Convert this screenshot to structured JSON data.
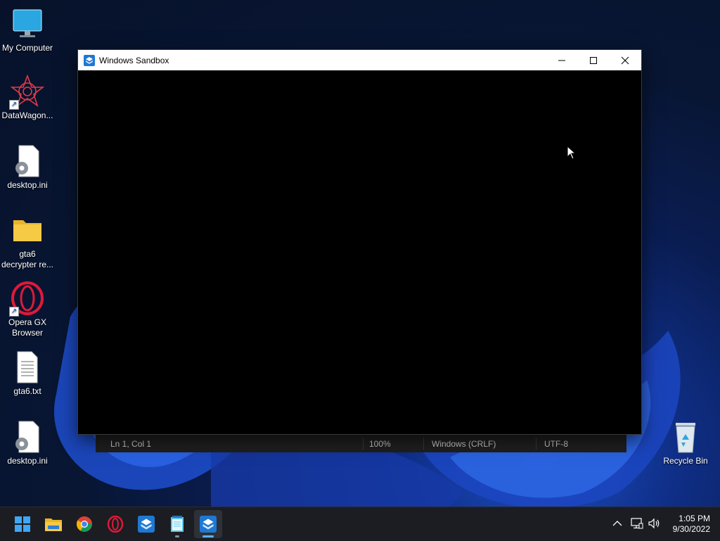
{
  "desktop": {
    "icons": [
      {
        "label": "My Computer"
      },
      {
        "label": "DataWagon..."
      },
      {
        "label": "desktop.ini"
      },
      {
        "label": "gta6\ndecrypter re..."
      },
      {
        "label": "Opera GX\nBrowser"
      },
      {
        "label": "gta6.txt"
      },
      {
        "label": "desktop.ini"
      }
    ],
    "recycle_bin": {
      "label": "Recycle Bin"
    }
  },
  "window": {
    "title": "Windows Sandbox",
    "icon": "sandbox-icon"
  },
  "statusbar": {
    "position": "Ln 1, Col 1",
    "zoom": "100%",
    "line_ending": "Windows (CRLF)",
    "encoding": "UTF-8"
  },
  "taskbar": {
    "items": [
      "start-icon",
      "file-explorer-icon",
      "chrome-icon",
      "opera-gx-icon",
      "sandbox-icon",
      "notepad-icon",
      "sandbox-icon"
    ],
    "time": "1:05 PM",
    "date": "9/30/2022"
  },
  "colors": {
    "accent": "#0078d4",
    "opera": "#e0193a",
    "folder": "#f3c530"
  }
}
